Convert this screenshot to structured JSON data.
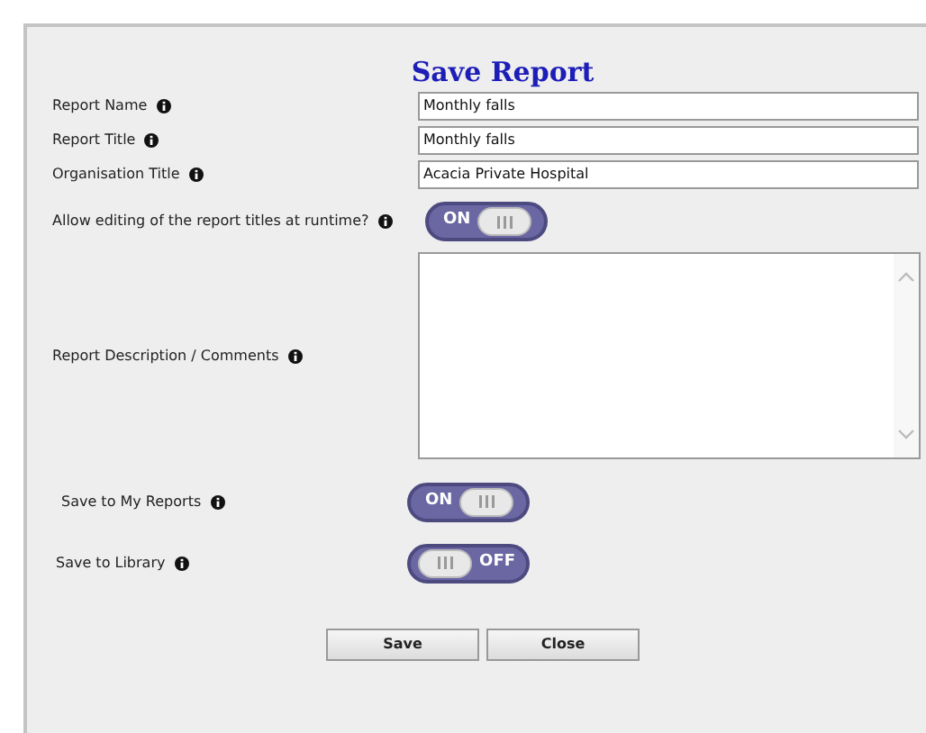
{
  "title": "Save Report",
  "fields": [
    {
      "label": "Report Name",
      "value": "Monthly falls"
    },
    {
      "label": "Report Title",
      "value": "Monthly falls"
    },
    {
      "label": "Organisation Title",
      "value": "Acacia Private Hospital"
    }
  ],
  "allow_editing": {
    "label": "Allow editing of the report titles at runtime?",
    "on": true,
    "text": "ON"
  },
  "description": {
    "label": "Report Description / Comments"
  },
  "save_options": [
    {
      "label": "Save to My Reports",
      "on": true,
      "text": "ON"
    },
    {
      "label": "Save to Library",
      "on": false,
      "text": "OFF"
    }
  ],
  "buttons": [
    "Save",
    "Close"
  ]
}
